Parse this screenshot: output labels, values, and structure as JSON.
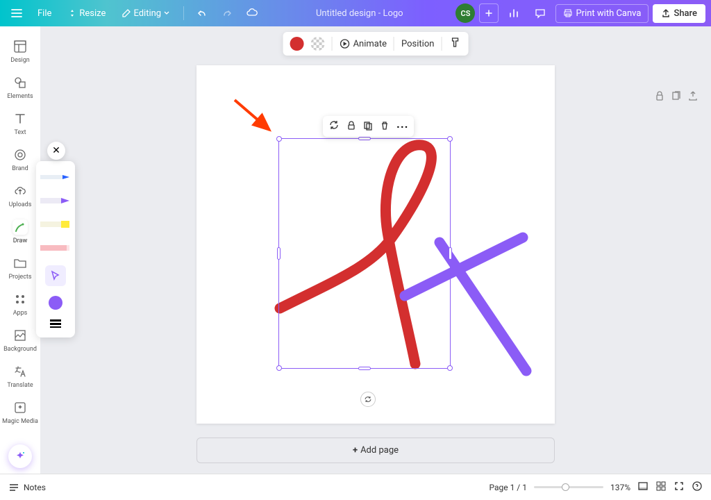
{
  "header": {
    "file": "File",
    "resize": "Resize",
    "editing": "Editing",
    "title": "Untitled design - Logo",
    "avatar": "CS",
    "print": "Print with Canva",
    "share": "Share"
  },
  "sidebar": {
    "items": [
      {
        "label": "Design"
      },
      {
        "label": "Elements"
      },
      {
        "label": "Text"
      },
      {
        "label": "Brand"
      },
      {
        "label": "Uploads"
      },
      {
        "label": "Draw"
      },
      {
        "label": "Projects"
      },
      {
        "label": "Apps"
      },
      {
        "label": "Background"
      },
      {
        "label": "Translate"
      },
      {
        "label": "Magic Media"
      }
    ]
  },
  "context": {
    "animate": "Animate",
    "position": "Position"
  },
  "canvas": {
    "add_page": "Add page"
  },
  "footer": {
    "notes": "Notes",
    "page_indicator": "Page 1 / 1",
    "zoom": "137%"
  },
  "colors": {
    "red": "#d32f2f",
    "purple": "#8b5cf6"
  }
}
